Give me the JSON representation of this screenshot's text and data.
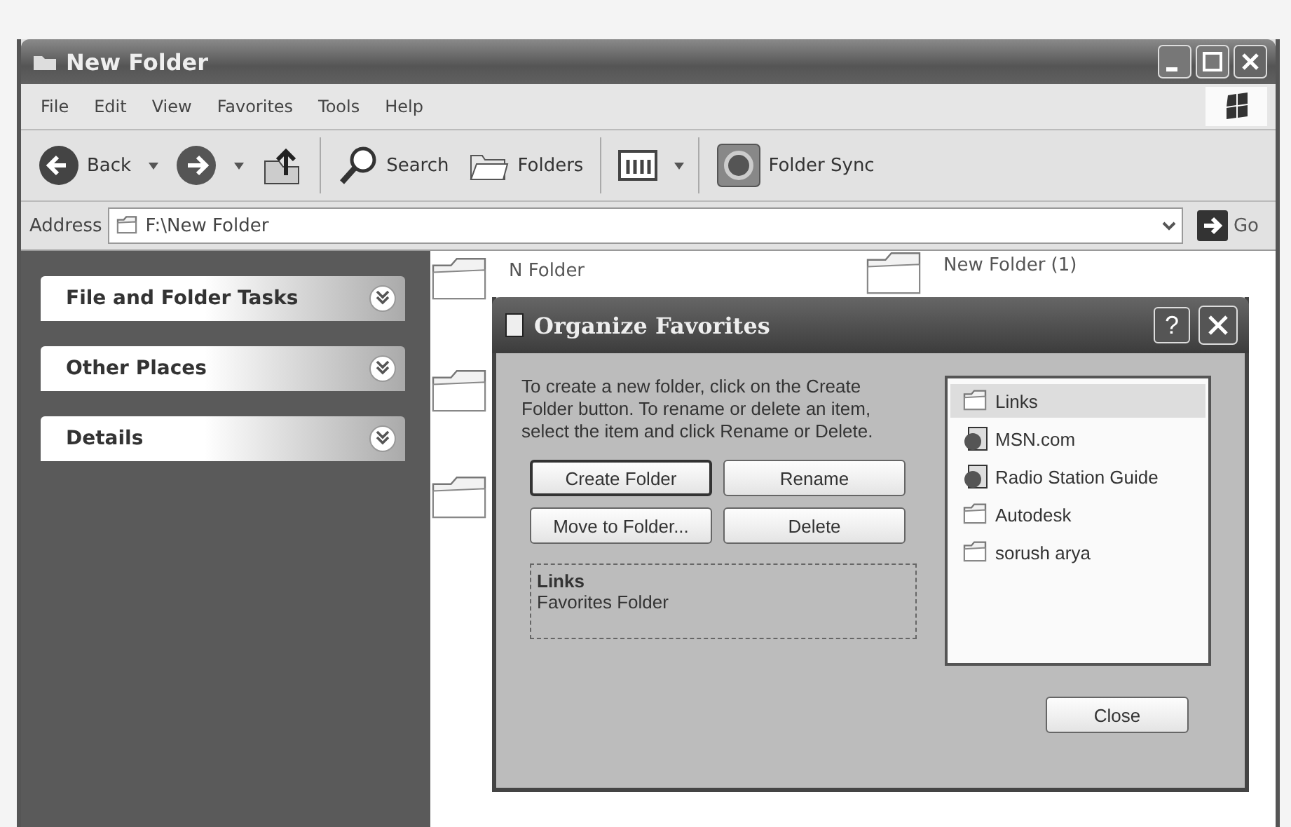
{
  "window": {
    "title": "New Folder"
  },
  "menu": [
    "File",
    "Edit",
    "View",
    "Favorites",
    "Tools",
    "Help"
  ],
  "toolbar": [
    {
      "kind": "back",
      "label": "Back"
    },
    {
      "kind": "forward"
    },
    {
      "kind": "up"
    },
    {
      "kind": "search",
      "label": "Search"
    },
    {
      "kind": "folders",
      "label": "Folders"
    },
    {
      "kind": "views"
    },
    {
      "kind": "sync",
      "label": "Folder Sync"
    }
  ],
  "address": {
    "label": "Address",
    "value": "F:\\New Folder",
    "go": "Go"
  },
  "task_pane": [
    {
      "title": "File and Folder Tasks",
      "expanded": false
    },
    {
      "title": "Other Places",
      "expanded": false
    },
    {
      "title": "Details",
      "expanded": false
    }
  ],
  "folders": [
    {
      "kind": "folder",
      "name": "N Folder"
    },
    {
      "kind": "folder",
      "name": "New Folder (1)"
    },
    {
      "kind": "folder"
    },
    {
      "kind": "folder"
    }
  ],
  "dialog": {
    "title": "Organize Favorites",
    "help": "?",
    "instructions": "To create a new folder, click on the Create Folder button. To rename or delete an item, select the item and click Rename or Delete.",
    "buttons": [
      {
        "label": "Create Folder",
        "default": true
      },
      {
        "label": "Rename",
        "default": false
      },
      {
        "label": "Move to Folder...",
        "default": false
      },
      {
        "label": "Delete",
        "default": false
      }
    ],
    "info": {
      "name": "Links",
      "type": "Favorites Folder"
    },
    "items": [
      {
        "kind": "folder",
        "label": "Links",
        "selected": true
      },
      {
        "kind": "link",
        "label": "MSN.com",
        "selected": false
      },
      {
        "kind": "link",
        "label": "Radio Station Guide",
        "selected": false
      },
      {
        "kind": "folder",
        "label": "Autodesk",
        "selected": false
      },
      {
        "kind": "folder",
        "label": "sorush arya",
        "selected": false
      }
    ],
    "close": "Close"
  }
}
